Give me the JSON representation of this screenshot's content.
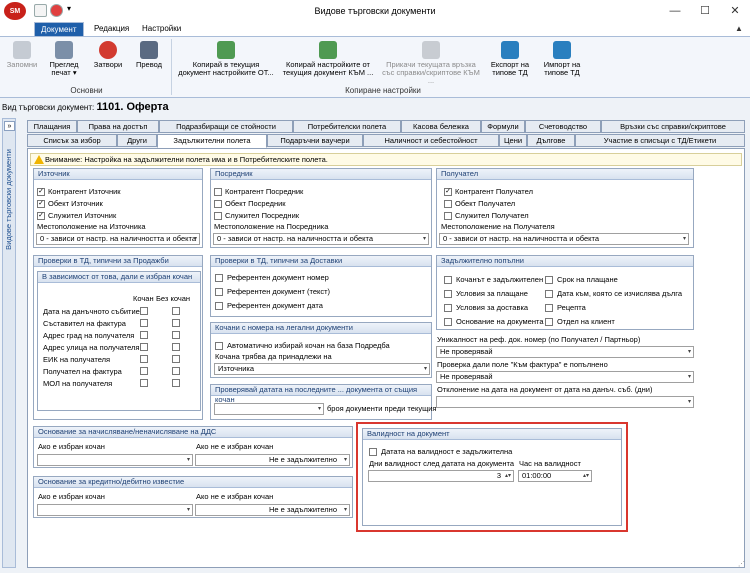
{
  "window": {
    "title": "Видове търговски документи",
    "logo": "SM",
    "min": "—",
    "max": "☐",
    "close": "✕"
  },
  "ribbon_tabs": [
    "Документ",
    "Редакция",
    "Настройки"
  ],
  "ribbon": {
    "group_basic": {
      "label": "Основни",
      "save": "Запомни",
      "preview": "Преглед печат",
      "preview_arrow": "▾",
      "close": "Затвори",
      "translate": "Превод"
    },
    "group_copy": {
      "label": "Копиране настройки",
      "copy_from": "Копирай в текущия документ настройките ОТ...",
      "copy_to": "Копирай настройките от текущия документ КЪМ ...",
      "attach": "Прикачи текущата връзка със справки/скриптове КЪМ ...",
      "export": "Експорт на типове ТД",
      "import": "Импорт на типове ТД"
    }
  },
  "doc_type": {
    "label": "Вид търговски документ:",
    "value": "1101. Оферта"
  },
  "sidebar": {
    "label": "Видове търговски документи",
    "chevron": "»"
  },
  "tabs_row1": [
    "Плащания",
    "Права на достъп",
    "Подразбиращи се стойности",
    "Потребителски полета",
    "Касова бележка",
    "Формули",
    "Счетоводство",
    "Връзки със справки/скриптове"
  ],
  "tabs_row2": [
    "Списък за избор",
    "Други",
    "Задължителни полета",
    "Подаръчни ваучери",
    "Наличност и себестойност",
    "Цени",
    "Дългове",
    "Участие в списъци с ТД/Етикети"
  ],
  "warning": "Внимание: Настройка на задължителни полета има и в Потребителските полета.",
  "source": {
    "title": "Източник",
    "items": [
      {
        "label": "Контрагент Източник",
        "checked": true
      },
      {
        "label": "Обект Източник",
        "checked": true
      },
      {
        "label": "Служител Източник",
        "checked": true
      }
    ],
    "loc_label": "Местоположение на Източника",
    "loc_value": "0 - зависи от настр. на наличността и обекта"
  },
  "intermediary": {
    "title": "Посредник",
    "items": [
      {
        "label": "Контрагент Посредник",
        "checked": false
      },
      {
        "label": "Обект Посредник",
        "checked": false
      },
      {
        "label": "Служител Посредник",
        "checked": false
      }
    ],
    "loc_label": "Местоположение на Посредника",
    "loc_value": "0 - зависи от настр. на наличността и обекта"
  },
  "recipient": {
    "title": "Получател",
    "items": [
      {
        "label": "Контрагент Получател",
        "checked": true
      },
      {
        "label": "Обект Получател",
        "checked": false
      },
      {
        "label": "Служител Получател",
        "checked": false
      }
    ],
    "loc_label": "Местоположение на Получателя",
    "loc_value": "0 - зависи от настр. на наличността и обекта"
  },
  "checks_sales": {
    "title": "Проверки в ТД, типични за Продажби",
    "sub_title": "В зависимост от това, дали е избран кочан",
    "col1": "Кочан",
    "col2": "Без кочан",
    "rows": [
      "Дата на данъчното събитие",
      "Съставител на фактура",
      "Адрес град на получателя",
      "Адрес улица на получателя",
      "ЕИК на получателя",
      "Получател на фактура",
      "МОЛ на получателя"
    ]
  },
  "checks_delivery": {
    "title": "Проверки в ТД, типични за Доставки",
    "items": [
      "Референтен документ номер",
      "Референтен документ (текст)",
      "Референтен документ дата"
    ]
  },
  "legal_books": {
    "title": "Кочани с номера на легални документи",
    "auto_label": "Автоматично избирай кочан на база Подредба",
    "belongs_label": "Кочана трябва да принадлежи на",
    "belongs_value": "Източника"
  },
  "date_check": {
    "title": "Проверявай датата на последните ... документа от същия кочан",
    "suffix": "броя документи преди текущия"
  },
  "required": {
    "title": "Задължително попълни",
    "left": [
      "Кочанът е задължителен",
      "Условия за плащане",
      "Условия за доставка",
      "Основание на документа"
    ],
    "right": [
      "Срок на плащане",
      "Дата към, която се изчислява дълга",
      "Рецепта",
      "Отдел на клиент"
    ]
  },
  "uniqueness": {
    "label": "Уникалност на реф. док. номер (по Получател / Партньор)",
    "value": "Не проверявай"
  },
  "invoice_check": {
    "label": "Проверка дали поле \"Към фактура\" е попълнено",
    "value": "Не проверявай"
  },
  "deviation": {
    "label": "Отклонение на дата на документ от дата на данъч. съб. (дни)"
  },
  "vat_basis": {
    "title": "Основание за начисляване/неначисляване на ДДС",
    "left_label": "Ако е избран кочан",
    "right_label": "Ако не е избран кочан",
    "right_value": "Не е задължително"
  },
  "credit_basis": {
    "title": "Основание за кредитно/дебитно известие",
    "left_label": "Ако е избран кочан",
    "right_label": "Ако не е избран кочан",
    "right_value": "Не е задължително"
  },
  "validity": {
    "title": "Валидност на документ",
    "check_label": "Датата на валидност е задължителна",
    "days_label": "Дни валидност след датата на документа",
    "days_value": "3",
    "hour_label": "Час на валидност",
    "hour_value": "01:00:00"
  }
}
